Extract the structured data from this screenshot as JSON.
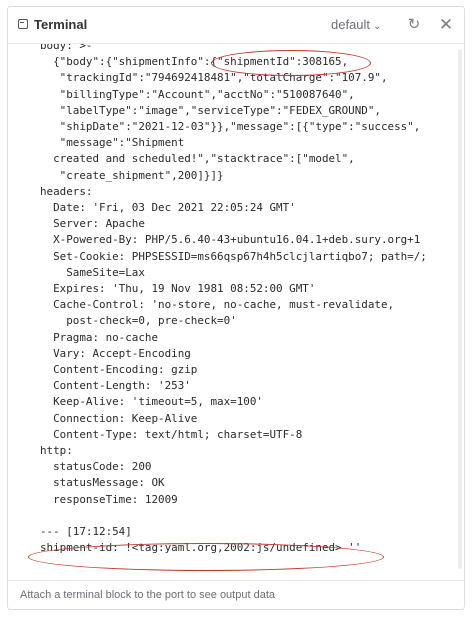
{
  "header": {
    "title": "Terminal",
    "environment": "default",
    "icons": [
      "terminal-icon",
      "chevron-down-icon",
      "refresh-icon",
      "close-icon"
    ]
  },
  "output_lines": [
    "body: >-",
    "  {\"body\":{\"shipmentInfo\":{\"shipmentId\":308165,",
    "   \"trackingId\":\"794692418481\",\"totalCharge\":\"107.9\",",
    "   \"billingType\":\"Account\",\"acctNo\":\"510087640\",",
    "   \"labelType\":\"image\",\"serviceType\":\"FEDEX_GROUND\",",
    "   \"shipDate\":\"2021-12-03\"}},\"message\":[{\"type\":\"success\",",
    "   \"message\":\"Shipment",
    "  created and scheduled!\",\"stacktrace\":[\"model\",",
    "   \"create_shipment\",200]}]}",
    "headers:",
    "  Date: 'Fri, 03 Dec 2021 22:05:24 GMT'",
    "  Server: Apache",
    "  X-Powered-By: PHP/5.6.40-43+ubuntu16.04.1+deb.sury.org+1",
    "  Set-Cookie: PHPSESSID=ms66qsp67h4h5clcjlartiqbo7; path=/;",
    "    SameSite=Lax",
    "  Expires: 'Thu, 19 Nov 1981 08:52:00 GMT'",
    "  Cache-Control: 'no-store, no-cache, must-revalidate,",
    "    post-check=0, pre-check=0'",
    "  Pragma: no-cache",
    "  Vary: Accept-Encoding",
    "  Content-Encoding: gzip",
    "  Content-Length: '253'",
    "  Keep-Alive: 'timeout=5, max=100'",
    "  Connection: Keep-Alive",
    "  Content-Type: text/html; charset=UTF-8",
    "http:",
    "  statusCode: 200",
    "  statusMessage: OK",
    "  responseTime: 12009",
    "",
    "--- [17:12:54]",
    "shipment-id: !<tag:yaml.org,2002:js/undefined> ''"
  ],
  "footer": {
    "hint": "Attach a terminal block to the port to see output data"
  },
  "colors": {
    "annotation": "#c0392b",
    "code_text": "#2a2a2a"
  }
}
